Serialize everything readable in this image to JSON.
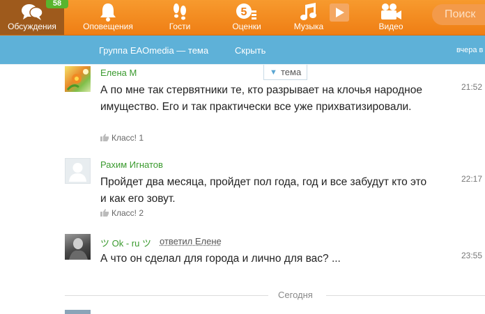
{
  "nav": {
    "items": [
      {
        "label": "Обсуждения",
        "icon": "chat-bubbles-icon",
        "badge": "58"
      },
      {
        "label": "Оповещения",
        "icon": "bell-icon"
      },
      {
        "label": "Гости",
        "icon": "footprints-icon"
      },
      {
        "label": "Оценки",
        "icon": "rating-5-icon"
      },
      {
        "label": "Музыка",
        "icon": "music-note-icon"
      },
      {
        "label": "Видео",
        "icon": "video-camera-icon"
      }
    ],
    "search_placeholder": "Поиск"
  },
  "subbar": {
    "group_title": "Группа EAOmedia — тема",
    "hide_label": "Скрыть",
    "right_text": "вчера в"
  },
  "topic_tab": "тема",
  "messages": [
    {
      "author": "Елена М",
      "text": "А по мне так стервятники те, кто разрывает на клочья народное имущество. Его и так практически все уже прихватизировали.",
      "time": "21:52",
      "klass": "Класс! 1"
    },
    {
      "author": "Рахим Игнатов",
      "text": "Пройдет два месяца, пройдет пол года, год и все забудут кто это и как его зовут.",
      "time": "22:17",
      "klass": "Класс! 2"
    },
    {
      "author": "ツ Ok - ru ツ",
      "reply_to": "ответил Елене",
      "text": "А что он сделал для города и лично для вас? ...",
      "time": "23:55"
    }
  ],
  "separator": "Сегодня",
  "colors": {
    "nav_orange": "#ef7e14",
    "subbar_blue": "#5eb1d8",
    "author_green": "#3a9a2e",
    "badge_green": "#59b52e"
  }
}
